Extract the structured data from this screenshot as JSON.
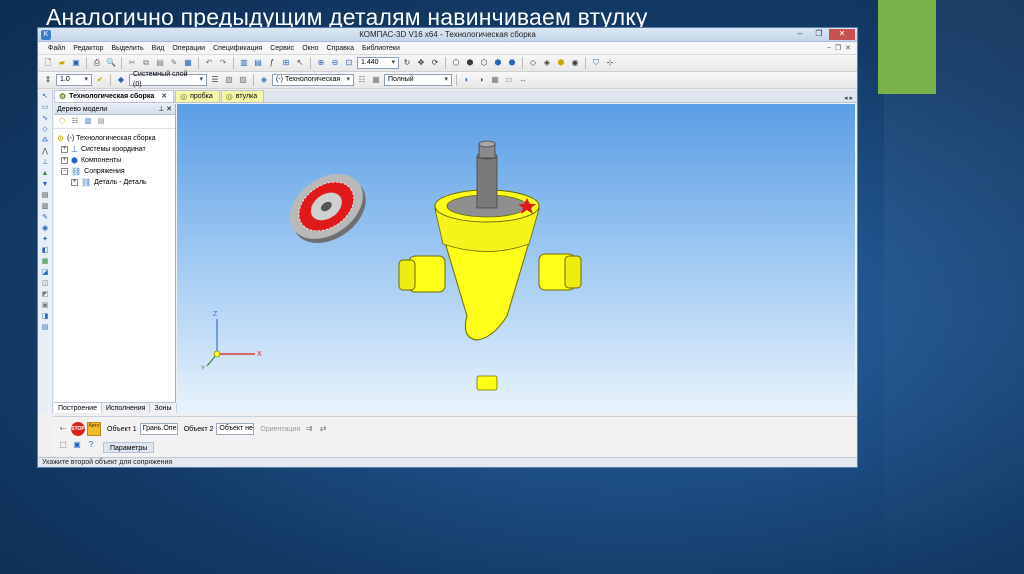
{
  "slide": {
    "title": "Аналогично предыдущим деталям навинчиваем втулку"
  },
  "window": {
    "title": "КОМПАС-3D V16  x64 - Технологическая сборка",
    "buttons": [
      "–",
      "❐",
      "✕"
    ]
  },
  "menu": [
    "Файл",
    "Редактор",
    "Выделить",
    "Вид",
    "Операции",
    "Спецификация",
    "Сервис",
    "Окно",
    "Справка",
    "Библиотеки"
  ],
  "toolbar1": {
    "zoom_value": "1.440"
  },
  "toolbar2": {
    "step_value": "1.0",
    "layer_value": "Системный слой (0)",
    "orientation_value": "(-) Технологическая",
    "display_mode": "Полный"
  },
  "doc_tabs": [
    {
      "label": "Технологическая сборка",
      "active": true
    },
    {
      "label": "пробка",
      "active": false
    },
    {
      "label": "втулка",
      "active": false
    }
  ],
  "tree": {
    "header": "Дерево модели",
    "items": [
      {
        "label": "(-) Технологическая сборка",
        "level": 0
      },
      {
        "label": "Системы координат",
        "level": 1
      },
      {
        "label": "Компоненты",
        "level": 1
      },
      {
        "label": "Сопряжения",
        "level": 1
      },
      {
        "label": "Деталь - Деталь",
        "level": 2
      }
    ],
    "bottom_tabs": [
      "Построение",
      "Исполнения",
      "Зоны"
    ]
  },
  "axes": {
    "x": "X",
    "y": "Y",
    "z": "Z"
  },
  "properties": {
    "object1_label": "Объект 1",
    "object1_value": "Грань.Опер",
    "object2_label": "Объект 2",
    "object2_value": "Объект не с",
    "orientation_label": "Ориентация",
    "stop_text": "STOP",
    "auto_text": "Авто",
    "params_tab": "Параметры"
  },
  "status": {
    "text": "Укажите второй объект для сопряжения"
  },
  "colors": {
    "slide_bg": "#1d4f86",
    "accent": "#7ab24a",
    "part_yellow": "#ffff1a",
    "selection_red": "#e01a1a"
  }
}
